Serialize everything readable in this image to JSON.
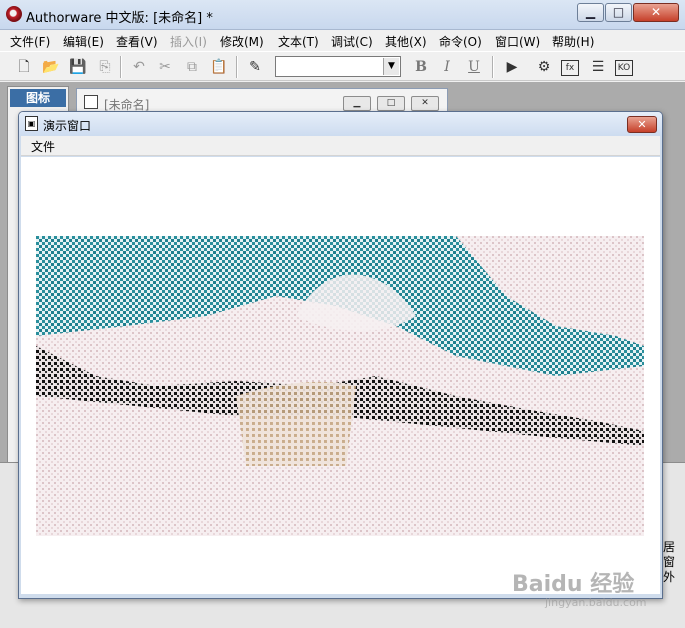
{
  "window": {
    "title": "Authorware 中文版: [未命名] *",
    "minimize": "▁",
    "maximize": "□",
    "close": "✕"
  },
  "menu": [
    {
      "label": "文件(F)",
      "enabled": true
    },
    {
      "label": "编辑(E)",
      "enabled": true
    },
    {
      "label": "查看(V)",
      "enabled": true
    },
    {
      "label": "插入(I)",
      "enabled": false
    },
    {
      "label": "修改(M)",
      "enabled": true
    },
    {
      "label": "文本(T)",
      "enabled": true
    },
    {
      "label": "调试(C)",
      "enabled": true
    },
    {
      "label": "其他(X)",
      "enabled": true
    },
    {
      "label": "命令(O)",
      "enabled": true
    },
    {
      "label": "窗口(W)",
      "enabled": true
    },
    {
      "label": "帮助(H)",
      "enabled": true
    }
  ],
  "toolbar": {
    "font_value": "",
    "bold": "B",
    "italic": "I",
    "underline": "U"
  },
  "icon_palette": {
    "title": "图标"
  },
  "flow_window": {
    "title": "[未命名]"
  },
  "presentation": {
    "title": "演示窗口",
    "menu_file": "文件"
  },
  "right_clip_text": [
    "居",
    "窗",
    "外"
  ],
  "watermark": {
    "brand": "Baidu 经验",
    "url": "jingyan.baidu.com"
  },
  "colors": {
    "accent_teal": "#2a8f9c",
    "close_red": "#c6402a"
  }
}
